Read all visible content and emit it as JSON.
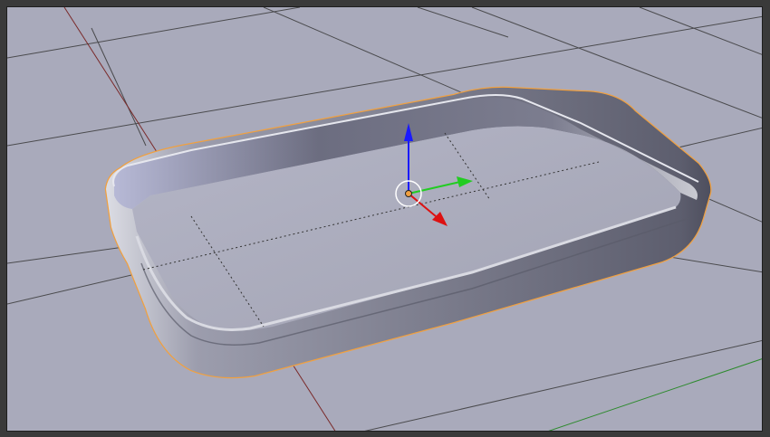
{
  "app": {
    "name": ""
  },
  "viewport": {
    "background_color": "#aaabbc",
    "grid_color": "#3a3a3a",
    "x_axis_color": "#8a3030",
    "y_axis_color": "#2a8a2a",
    "object": {
      "name": "",
      "selected": true,
      "selection_outline_color": "#f0a040",
      "body_color": "#8d8ea0"
    },
    "manipulator": {
      "z_color": "#1a1aff",
      "y_color": "#22cc22",
      "x_color": "#dd1111",
      "origin_color": "#f0a040"
    }
  }
}
